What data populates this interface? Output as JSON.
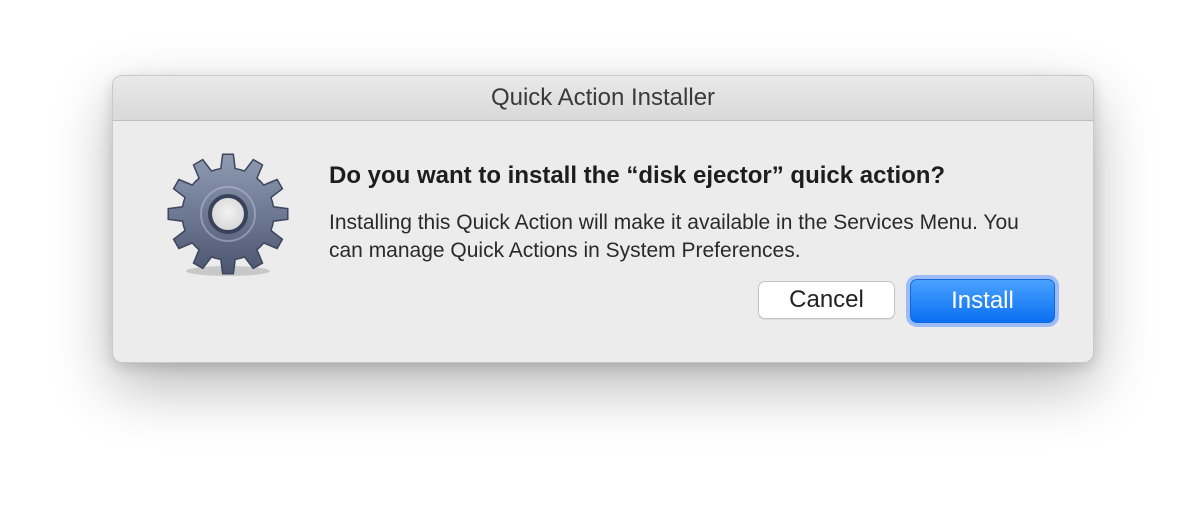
{
  "window": {
    "title": "Quick Action Installer"
  },
  "dialog": {
    "icon": "gear-icon",
    "heading": "Do you want to install the “disk ejector” quick action?",
    "message": "Installing this Quick Action will make it available in the Services Menu. You can manage Quick Actions in System Preferences."
  },
  "buttons": {
    "cancel_label": "Cancel",
    "install_label": "Install"
  },
  "colors": {
    "accent": "#0a6ff2",
    "window_background": "#ececec"
  }
}
